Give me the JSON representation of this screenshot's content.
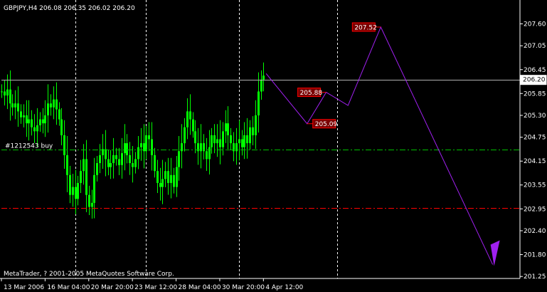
{
  "window": {
    "header": "GBPJPY,H4  206.08 206.35 206.02 206.20",
    "copyright": "MetaTrader, ? 2001-2005 MetaQuotes Software Corp."
  },
  "colors": {
    "background": "#000000",
    "candles": "#00ff00",
    "frame": "#ffffff",
    "current_price_line": "#b0b0b0",
    "buy_line": "#00c000",
    "stop_line": "#ff0000",
    "projection": "#a020f0",
    "label_border": "#ff0000",
    "label_fill": "#7a0000",
    "vertical_separators": "#ffffff"
  },
  "orders": {
    "buy_label": "#1212543 buy",
    "buy_price": 204.44,
    "stop_price": 202.98
  },
  "current_price": {
    "value": 206.2,
    "label": "206.20"
  },
  "projection_labels": [
    {
      "id": "label-207-52",
      "text": "207.52"
    },
    {
      "id": "label-205-88",
      "text": "205.88"
    },
    {
      "id": "label-205-09",
      "text": "205.09"
    }
  ],
  "chart_data": {
    "type": "candlestick",
    "ylim": [
      201.2,
      208.2
    ],
    "y_ticks": [
      "207.60",
      "207.05",
      "206.45",
      "205.85",
      "205.30",
      "204.75",
      "204.15",
      "203.55",
      "202.95",
      "202.40",
      "201.80",
      "201.25"
    ],
    "y_tick_values": [
      207.6,
      207.05,
      206.45,
      205.85,
      205.3,
      204.75,
      204.15,
      203.55,
      202.95,
      202.4,
      201.8,
      201.25
    ],
    "x_ticks": [
      "13 Mar 2006",
      "16 Mar 04:00",
      "20 Mar 20:00",
      "23 Mar 12:00",
      "28 Mar 04:00",
      "30 Mar 20:00",
      "4 Apr 12:00"
    ],
    "x_tick_bars": [
      0,
      16,
      32,
      48,
      64,
      80,
      96
    ],
    "x_bar_range": [
      0,
      190
    ],
    "vertical_separator_bars": [
      27,
      53,
      87,
      123
    ],
    "price_series": [
      205.9,
      205.8,
      205.95,
      205.6,
      205.5,
      205.6,
      205.4,
      205.25,
      205.3,
      205.1,
      205.2,
      205.0,
      204.9,
      205.05,
      205.2,
      205.1,
      205.3,
      205.6,
      205.5,
      205.7,
      205.45,
      205.2,
      204.8,
      204.3,
      203.8,
      203.3,
      203.5,
      203.2,
      203.6,
      203.9,
      204.2,
      203.3,
      203.0,
      203.1,
      203.8,
      204.1,
      204.3,
      204.45,
      204.2,
      204.0,
      204.1,
      204.3,
      204.2,
      204.05,
      204.35,
      204.6,
      204.3,
      204.1,
      204.0,
      204.2,
      204.5,
      204.6,
      204.4,
      204.8,
      204.7,
      204.3,
      203.9,
      203.6,
      203.5,
      203.7,
      203.9,
      203.6,
      203.8,
      203.5,
      204.0,
      204.4,
      204.6,
      205.0,
      205.4,
      205.2,
      204.9,
      204.6,
      204.4,
      204.6,
      204.4,
      204.2,
      204.5,
      204.8,
      204.6,
      204.7,
      204.5,
      204.9,
      205.1,
      204.8,
      204.6,
      204.4,
      204.6,
      204.7,
      204.5,
      204.8,
      204.6,
      205.0,
      204.8,
      205.3,
      205.9,
      206.2,
      206.3
    ],
    "projection": [
      {
        "bar": 97,
        "price": 206.35
      },
      {
        "bar": 112,
        "price": 205.09
      },
      {
        "bar": 119,
        "price": 205.88
      },
      {
        "bar": 127,
        "price": 205.55
      },
      {
        "bar": 139,
        "price": 207.52
      },
      {
        "bar": 180,
        "price": 201.55
      }
    ]
  }
}
